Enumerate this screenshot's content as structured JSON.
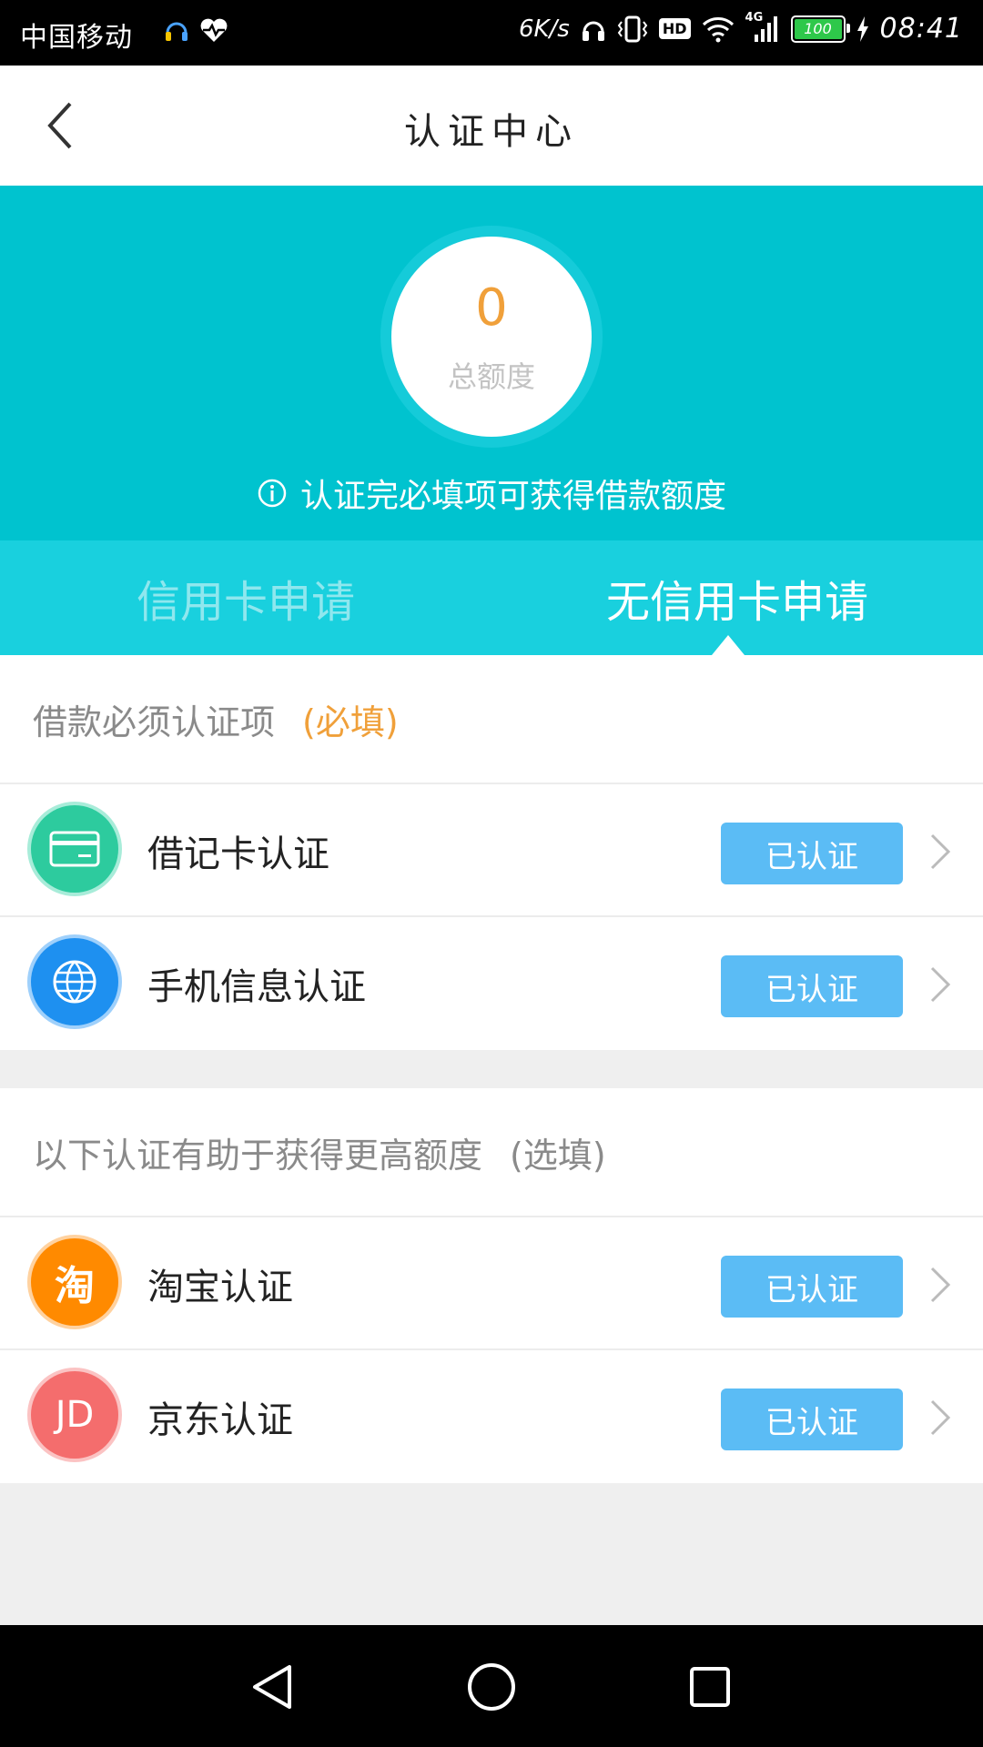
{
  "status_bar": {
    "carrier": "中国移动",
    "speed": "6K/s",
    "hd_badge": "HD",
    "network": "4G",
    "battery": "100",
    "time": "08:41"
  },
  "header": {
    "title": "认证中心",
    "back_icon": "chevron-left-icon"
  },
  "hero": {
    "amount": "0",
    "amount_label": "总额度",
    "hint": "认证完必填项可获得借款额度"
  },
  "tabs": [
    {
      "label": "信用卡申请",
      "active": false
    },
    {
      "label": "无信用卡申请",
      "active": true
    }
  ],
  "required_section": {
    "title": "借款必须认证项",
    "tag": "(必填)",
    "items": [
      {
        "label": "借记卡认证",
        "status": "已认证",
        "icon": "bank-card-icon",
        "color": "#2dcb9e"
      },
      {
        "label": "手机信息认证",
        "status": "已认证",
        "icon": "globe-phone-icon",
        "color": "#1e90f0"
      }
    ]
  },
  "optional_section": {
    "title": "以下认证有助于获得更高额度",
    "tag": "(选填)",
    "items": [
      {
        "label": "淘宝认证",
        "status": "已认证",
        "icon": "taobao-icon",
        "icon_text": "淘",
        "color": "#ff8a00"
      },
      {
        "label": "京东认证",
        "status": "已认证",
        "icon": "jd-icon",
        "icon_text": "JD",
        "color": "#f46d6d"
      }
    ]
  },
  "colors": {
    "accent_teal": "#00c3cf",
    "amount_orange": "#f0a03a",
    "badge_blue": "#5bbcf5"
  }
}
